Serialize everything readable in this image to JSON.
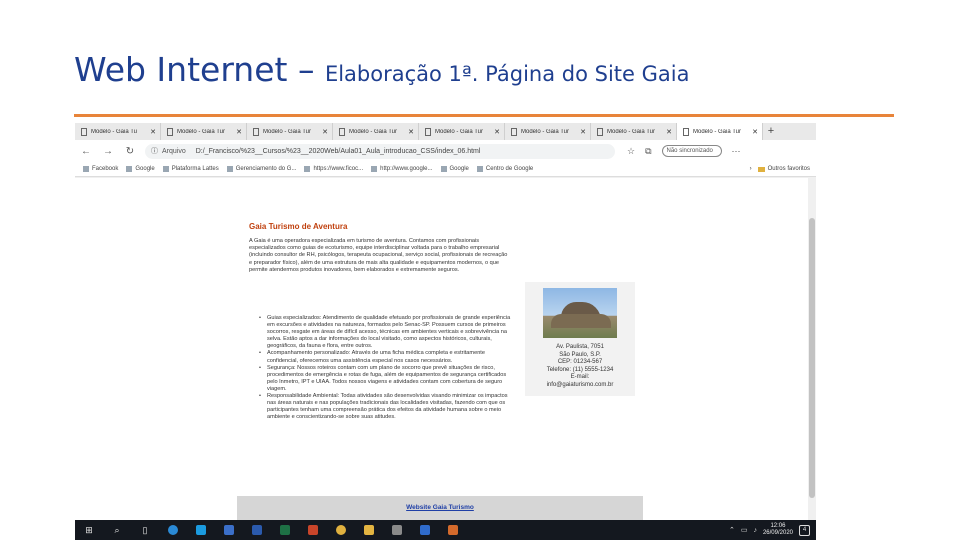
{
  "slide": {
    "title_main": "Web Internet – ",
    "title_sub": "Elaboração 1ª. Página do Site Gaia",
    "rule_color": "#e8843a",
    "title_color": "#1f3f8f"
  },
  "browser": {
    "tabs": [
      {
        "label": "Modelo - Gaia Tu"
      },
      {
        "label": "Modelo - Gaia Tur"
      },
      {
        "label": "Modelo - Gaia Tur"
      },
      {
        "label": "Modelo - Gaia Tur"
      },
      {
        "label": "Modelo - Gaia Tur"
      },
      {
        "label": "Modelo - Gaia Tur"
      },
      {
        "label": "Modelo - Gaia Tur"
      },
      {
        "label": "Modelo - Gaia Tur",
        "active": true
      }
    ],
    "new_tab": "+",
    "address_label": "Arquivo",
    "url": "D:/_Francisco/%23__Cursos/%23__2020Web/Aula01_Aula_introducao_CSS/index_06.html",
    "search_placeholder": "Não sincronizado",
    "bookmarks": [
      "Facebook",
      "Google",
      "Plataforma Lattes",
      "Gerenciamento do G...",
      "https://www.ficoc...",
      "http://www.google...",
      "Google",
      "Centro de Google"
    ],
    "other_favorites": "Outros favoritos"
  },
  "site": {
    "title": "Gaia Turismo de Aventura",
    "intro": "A Gaia é uma operadora especializada em turismo de aventura. Contamos com profissionais especializados como guias de ecoturismo, equipe interdisciplinar voltada para o trabalho empresarial (incluindo consultor de RH, psicólogos, terapeuta ocupacional, serviço social, profissionais de recreação e preparador físico), além de uma estrutura de mais alta qualidade e equipamentos modernos, o que permite atendermos produtos inovadores, bem elaborados e extremamente seguros.",
    "bullets": [
      "Guias especializados: Atendimento de qualidade efetuado por profissionais de grande experiência em excursões e atividades na natureza, formados pelo Senac-SP. Possuem cursos de primeiros socorros, resgate em áreas de difícil acesso, técnicas em ambientes verticais e sobrevivência na selva. Estão aptos a dar informações do local visitado, como aspectos históricos, culturais, geográficos, da fauna e flora, entre outros.",
      "Acompanhamento personalizado: Através de uma ficha médica completa e estritamente confidencial, oferecemos uma assistência especial nos casos necessários.",
      "Segurança: Nossos roteiros contam com um plano de socorro que prevê situações de risco, procedimentos de emergência e rotas de fuga, além de equipamentos de segurança certificados pelo Inmetro, IPT e UIAA. Todos nossos viagens e atividades contam com cobertura de seguro viagem.",
      "Responsabilidade Ambiental: Todas atividades são desenvolvidas visando minimizar os impactos nas áreas naturais e nas populações tradicionais das localidades visitadas, fazendo com que os participantes tenham uma compreensão prática dos efeitos da atividade humana sobre o meio ambiente e conscientizando-se sobre suas atitudes."
    ],
    "contact": [
      "Av. Paulista, 7051",
      "São Paulo, S.P.",
      "CEP: 01234-567",
      "Telefone: (11) 5555-1234",
      "E-mail:",
      "info@gaiaturismo.com.br"
    ],
    "footer_link": "Website Gaia Turismo",
    "title_color": "#c0410f",
    "link_color": "#1f3fa6"
  },
  "taskbar": {
    "time": "12:06",
    "date": "26/09/2020",
    "notifications": "4"
  }
}
